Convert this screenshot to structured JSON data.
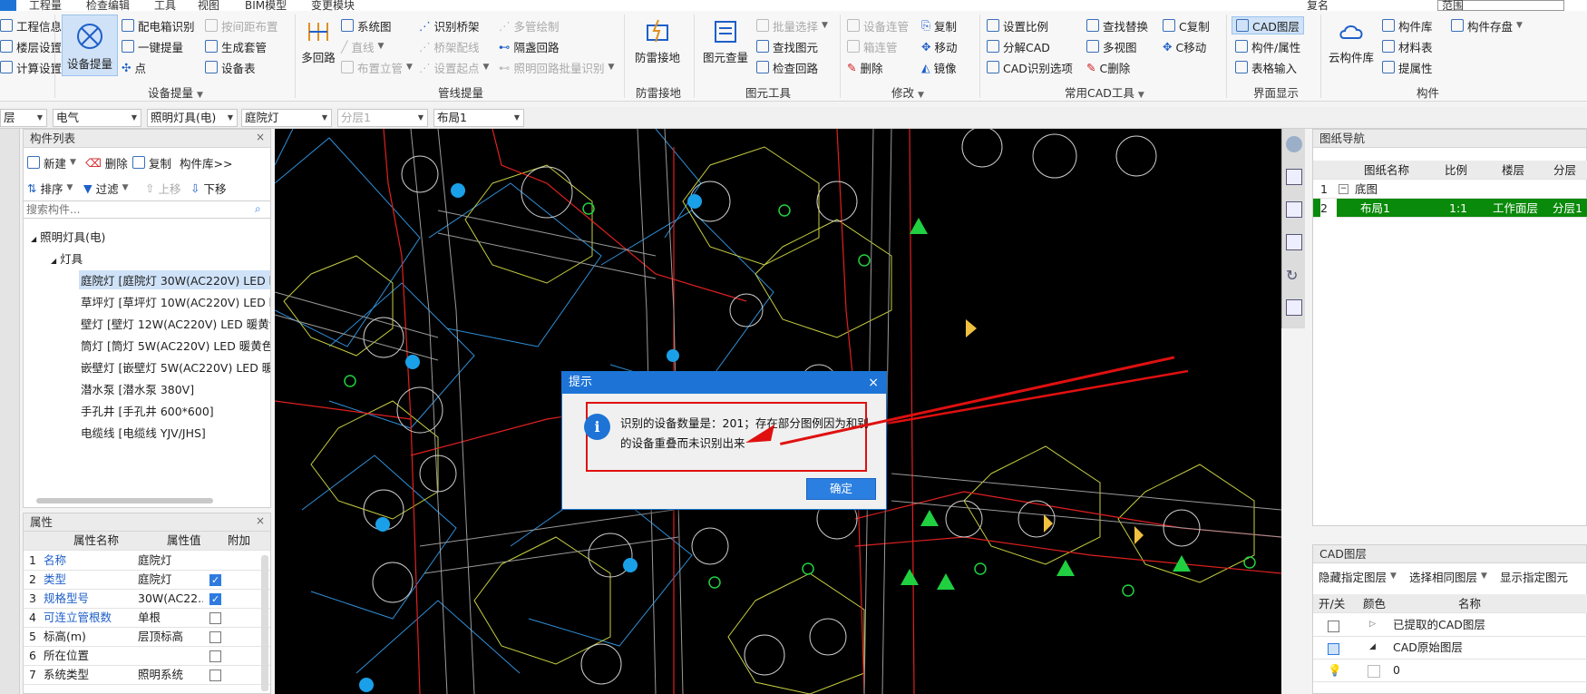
{
  "menu": {
    "items": [
      "工程量",
      "检查编辑",
      "工具",
      "视图",
      "BIM模型",
      "变更模块"
    ],
    "right_text": "复名",
    "search_value": "范围"
  },
  "ribbon": {
    "left_partial": [
      "工程信息",
      "楼层设置",
      "计算设置"
    ],
    "device": {
      "big": "设备提量",
      "items": [
        "配电箱识别",
        "一键提量",
        "点",
        "按间距布置",
        "生成套管",
        "设备表"
      ],
      "group": "设备提量"
    },
    "pipeline": {
      "big": "多回路",
      "items": [
        "系统图",
        "直线",
        "布置立管",
        "识别桥架",
        "桥架配线",
        "设置起点",
        "多管绘制",
        "隔盏回路",
        "照明回路批量识别"
      ],
      "group": "管线提量"
    },
    "lightning": {
      "big": "防雷接地",
      "group": "防雷接地"
    },
    "element_tools": {
      "big": "图元查量",
      "items": [
        "批量选择",
        "查找图元",
        "检查回路"
      ],
      "group": "图元工具"
    },
    "modify": {
      "items": [
        "设备连管",
        "箱连管",
        "删除",
        "复制",
        "移动",
        "镜像"
      ],
      "group": "修改"
    },
    "cad_tools": {
      "items": [
        "设置比例",
        "分解CAD",
        "CAD识别选项",
        "查找替换",
        "多视图",
        "C删除",
        "C复制",
        "C移动"
      ],
      "group": "常用CAD工具"
    },
    "ui_display": {
      "items": [
        "CAD图层",
        "构件/属性",
        "表格输入"
      ],
      "group": "界面显示"
    },
    "component": {
      "big": "云构件库",
      "items": [
        "构件库",
        "材料表",
        "提属性",
        "构件存盘"
      ],
      "group": "构件"
    }
  },
  "selectors": {
    "floor": "层",
    "discipline": "电气",
    "type": "照明灯具(电)",
    "item": "庭院灯",
    "layer": "分层1",
    "layout": "布局1"
  },
  "component_list": {
    "title": "构件列表",
    "toolbar": [
      "新建",
      "删除",
      "复制",
      "构件库>>",
      "排序",
      "过滤",
      "上移",
      "下移"
    ],
    "search_placeholder": "搜索构件...",
    "tree_root": "照明灯具(电)",
    "tree_group": "灯具",
    "items": [
      "庭院灯 [庭院灯 30W(AC220V) LED 暖",
      "草坪灯 [草坪灯 10W(AC220V) LED 暖黄",
      "壁灯 [壁灯 12W(AC220V) LED 暖黄色3",
      "筒灯 [筒灯 5W(AC220V) LED 暖黄色30",
      "嵌壁灯 [嵌壁灯 5W(AC220V) LED 暖黄",
      "潜水泵 [潜水泵 380V]",
      "手孔井 [手孔井 600*600]",
      "电缆线 [电缆线 YJV/JHS]"
    ]
  },
  "properties": {
    "title": "属性",
    "headers": [
      "属性名称",
      "属性值",
      "附加"
    ],
    "rows": [
      {
        "n": "1",
        "name": "名称",
        "value": "庭院灯",
        "blue": true,
        "check": null
      },
      {
        "n": "2",
        "name": "类型",
        "value": "庭院灯",
        "blue": true,
        "check": true
      },
      {
        "n": "3",
        "name": "规格型号",
        "value": "30W(AC22...",
        "blue": true,
        "check": true
      },
      {
        "n": "4",
        "name": "可连立管根数",
        "value": "单根",
        "blue": true,
        "check": false
      },
      {
        "n": "5",
        "name": "标高(m)",
        "value": "层顶标高",
        "blue": false,
        "check": false
      },
      {
        "n": "6",
        "name": "所在位置",
        "value": "",
        "blue": false,
        "check": false
      },
      {
        "n": "7",
        "name": "系统类型",
        "value": "照明系统",
        "blue": false,
        "check": false
      }
    ]
  },
  "dialog": {
    "title": "提示",
    "message_line1": "识别的设备数量是：201；存在部分图例因为和别",
    "message_line2": "的设备重叠而未识别出来",
    "ok": "确定",
    "close": "×"
  },
  "drawing_nav": {
    "title": "图纸导航",
    "headers": [
      "图纸名称",
      "比例",
      "楼层",
      "分层"
    ],
    "rows": [
      {
        "n": "1",
        "name": "底图",
        "scale": "",
        "floor": "",
        "layer": ""
      },
      {
        "n": "2",
        "name": "布局1",
        "scale": "1:1",
        "floor": "工作面层",
        "layer": "分层1"
      }
    ]
  },
  "cad_layers": {
    "title": "CAD图层",
    "toolbar": [
      "隐藏指定图层",
      "选择相同图层",
      "显示指定图元"
    ],
    "headers": [
      "开/关",
      "颜色",
      "名称"
    ],
    "rows": [
      "已提取的CAD图层",
      "CAD原始图层",
      "0"
    ]
  },
  "colors": {
    "accent": "#1d74d6",
    "selected_row": "#0a8a0a",
    "annotation_red": "#e01010"
  }
}
